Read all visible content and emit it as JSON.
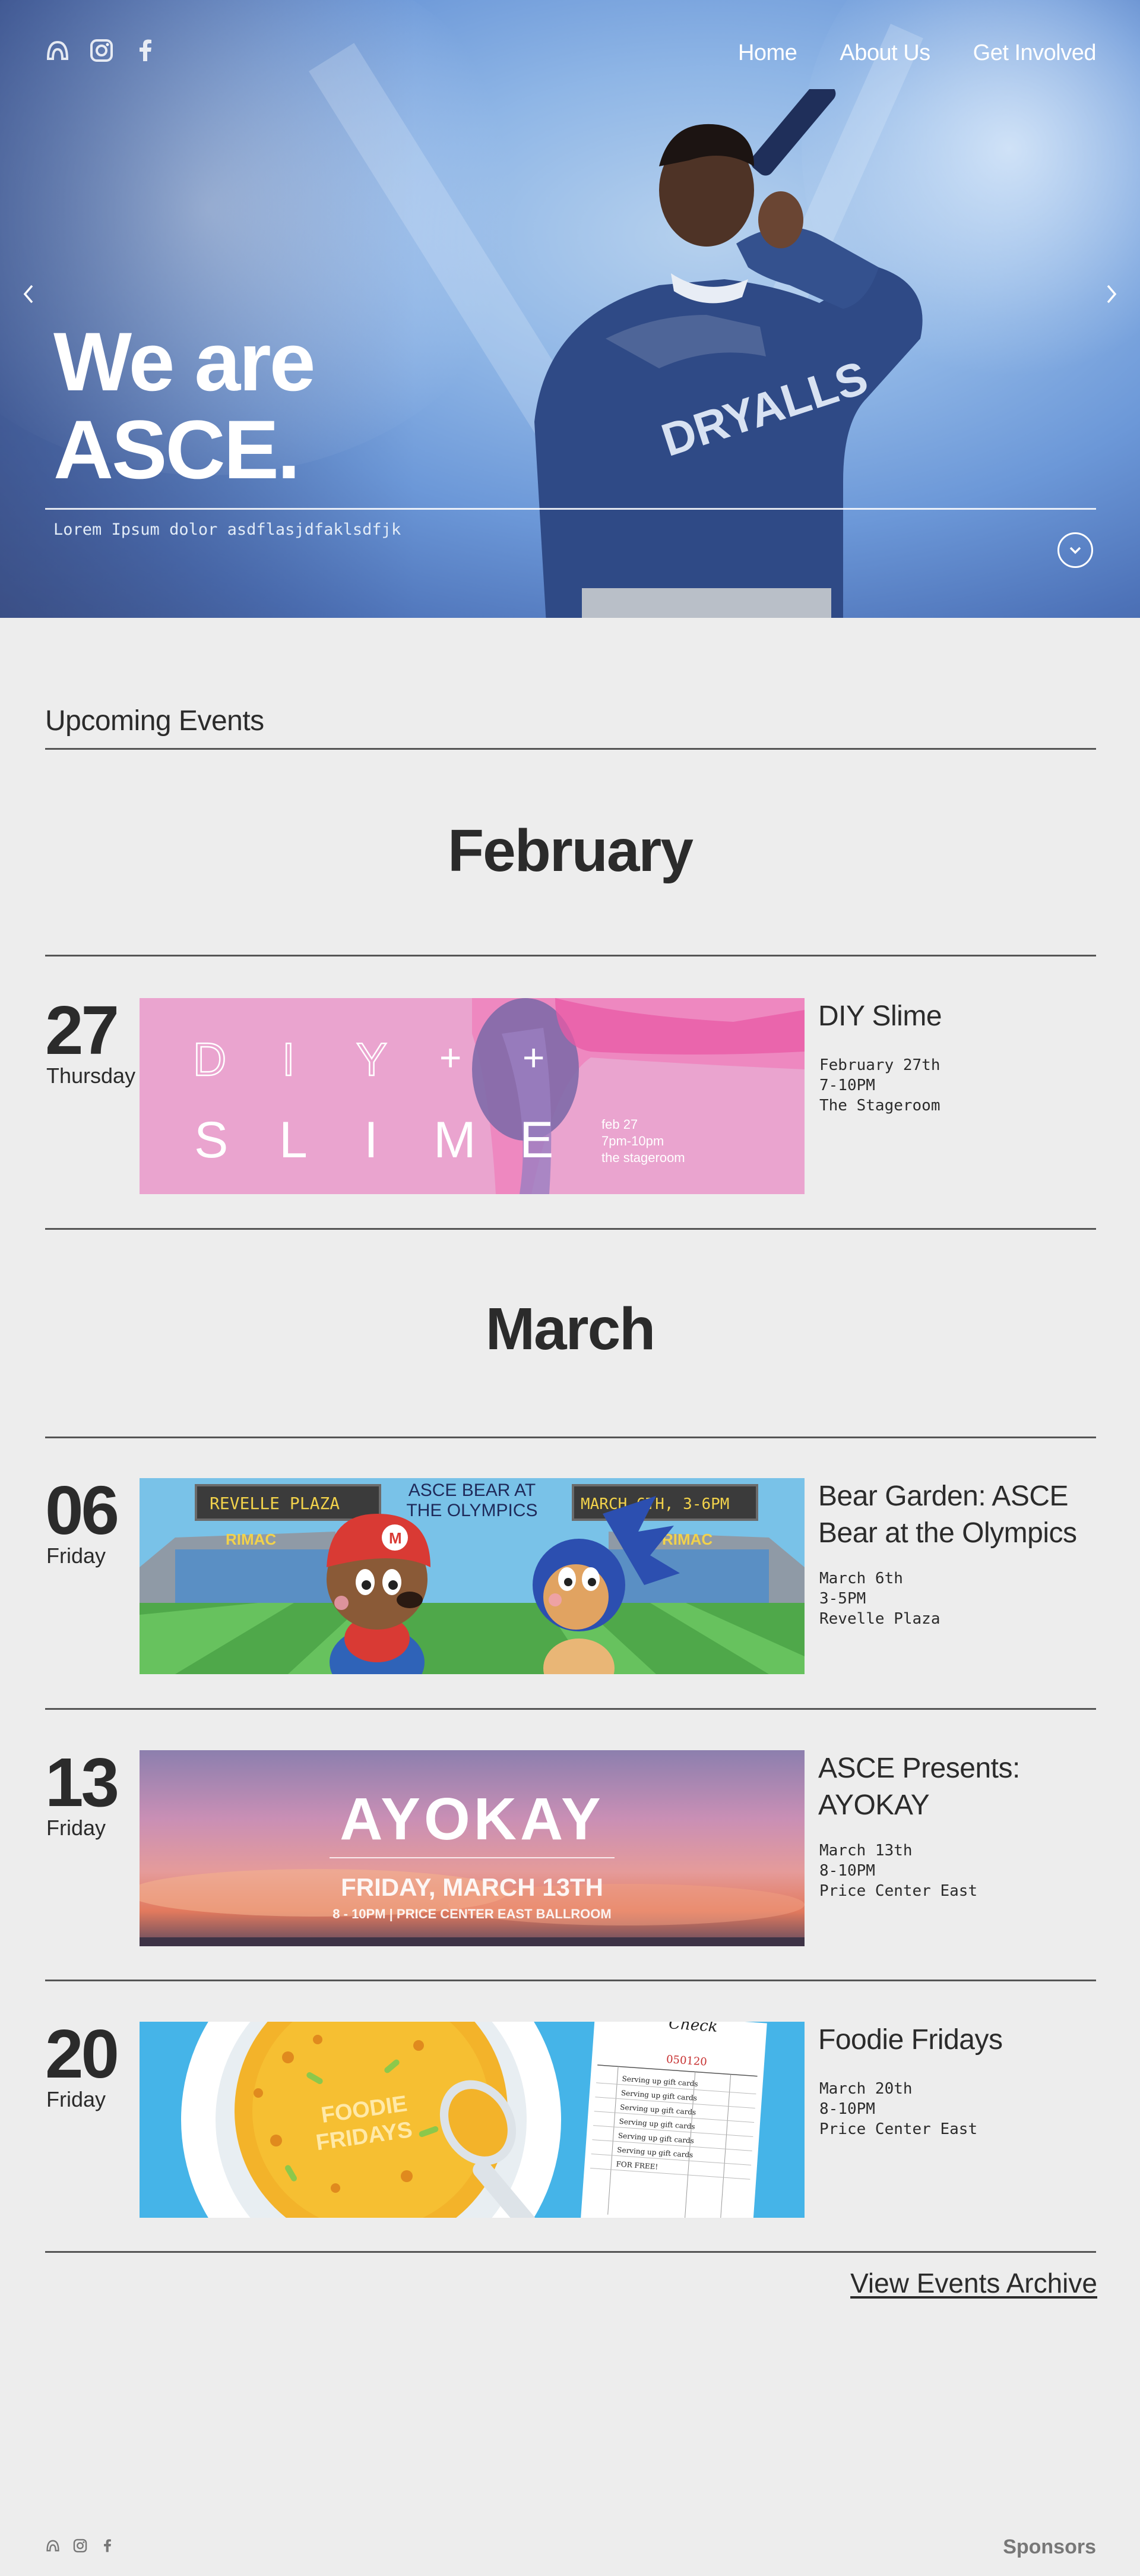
{
  "hero": {
    "icons": [
      "asce-logo-icon",
      "instagram-icon",
      "facebook-icon"
    ],
    "nav": [
      "Home",
      "About Us",
      "Get Involved"
    ],
    "title_line1": "We are",
    "title_line2": "ASCE.",
    "subtitle": "Lorem Ipsum dolor asdflasjdfaklsdfjk",
    "performer_shirt_text": "DRYALLS"
  },
  "events_section": {
    "title": "Upcoming Events",
    "months": [
      {
        "name": "February",
        "events": [
          {
            "day": "27",
            "weekday": "Thursday",
            "name": "DIY Slime",
            "details": [
              "February 27th",
              "7-10PM",
              "The Stageroom"
            ],
            "poster": {
              "line1": [
                "D",
                "I",
                "Y",
                "+",
                "+"
              ],
              "line2": [
                "S",
                "L",
                "I",
                "M",
                "E"
              ],
              "info": [
                "feb 27",
                "7pm-10pm",
                "the stageroom"
              ],
              "bg": "#eaa4cf"
            }
          }
        ]
      },
      {
        "name": "March",
        "events": [
          {
            "day": "06",
            "weekday": "Friday",
            "name": "Bear Garden: ASCE Bear at the Olympics",
            "details": [
              "March 6th",
              "3-5PM",
              "Revelle Plaza"
            ],
            "poster": {
              "sign_left": "REVELLE PLAZA",
              "sign_right": "MARCH 6TH, 3-6PM",
              "headline": [
                "ASCE BEAR AT",
                "THE OLYMPICS"
              ],
              "stand_text": "RIMAC",
              "bg": "#79c2e8"
            }
          },
          {
            "day": "13",
            "weekday": "Friday",
            "name": "ASCE Presents: AYOKAY",
            "details": [
              "March 13th",
              "8-10PM",
              "Price Center East"
            ],
            "poster": {
              "headline": "AYOKAY",
              "date": "FRIDAY, MARCH 13TH",
              "info": "8 - 10PM | PRICE CENTER EAST BALLROOM"
            }
          },
          {
            "day": "20",
            "weekday": "Friday",
            "name": "Foodie Fridays",
            "details": [
              "March 20th",
              "8-10PM",
              "Price Center East"
            ],
            "poster": {
              "bowl_text": [
                "FOODIE",
                "FRIDAYS"
              ],
              "check_title": "Check",
              "check_number": "050120",
              "rows": [
                "Serving up gift cards",
                "Serving up gift cards",
                "Serving up gift cards",
                "Serving up gift cards",
                "Serving up gift cards",
                "Serving up gift cards",
                "FOR FREE!"
              ],
              "bg": "#45b4e8"
            }
          }
        ]
      }
    ],
    "archive_link": "View Events Archive"
  },
  "footer": {
    "icons": [
      "asce-logo-icon",
      "instagram-icon",
      "facebook-icon"
    ],
    "sponsors": "Sponsors"
  },
  "colors": {
    "page_bg": "#ededed",
    "text": "#2b2b2b",
    "hero_blue": "#6c98d8"
  }
}
